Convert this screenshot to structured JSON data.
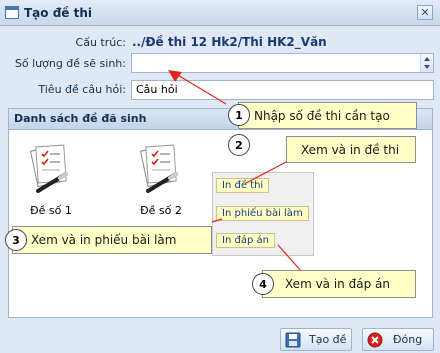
{
  "window": {
    "title": "Tạo đề thi",
    "close_glyph": "✕"
  },
  "form": {
    "structure_label": "Cấu trúc:",
    "structure_value": "../Đề thi 12 Hk2/Thi HK2_Văn",
    "count_label": "Số lượng đề sẽ sinh:",
    "count_value": "",
    "title_label": "Tiêu đề câu hỏi:",
    "title_value": "Câu hỏi"
  },
  "panel": {
    "title": "Danh sách đề đã sinh",
    "items": [
      {
        "label": "Đề số 1"
      },
      {
        "label": "Đề số 2"
      }
    ],
    "menu": [
      {
        "label": "In đề thi"
      },
      {
        "label": "In phiếu bài làm"
      },
      {
        "label": "In đáp án"
      }
    ]
  },
  "callouts": [
    {
      "num": "1",
      "text": "Nhập số đề thi cần tạo"
    },
    {
      "num": "2",
      "text": "Xem và in đề thi"
    },
    {
      "num": "3",
      "text": "Xem và in phiếu bài làm"
    },
    {
      "num": "4",
      "text": "Xem và in đáp án"
    }
  ],
  "footer": {
    "create_label": "Tạo đề",
    "close_label": "Đóng"
  },
  "colors": {
    "arrow": "#e0281e",
    "callout_bg": "#ffffc8"
  },
  "icons": [
    "window-icon",
    "document-pen-icon",
    "save-icon",
    "close-circle-icon"
  ]
}
